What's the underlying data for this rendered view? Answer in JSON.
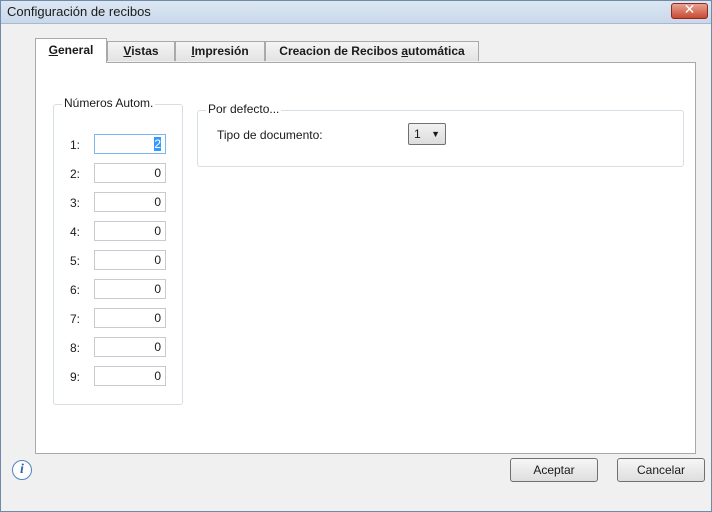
{
  "window": {
    "title": "Configuración de recibos",
    "close_glyph": "✕"
  },
  "tabs": [
    {
      "label_u": "G",
      "label_rest": "eneral",
      "active": true
    },
    {
      "label_u": "V",
      "label_rest": "istas"
    },
    {
      "label_u": "I",
      "label_rest": "mpresión"
    },
    {
      "label_pre": "Creacion de Recibos ",
      "label_u": "a",
      "label_rest": "utomática"
    }
  ],
  "numeros_group": {
    "legend": "Números Autom.",
    "rows": [
      {
        "label": "1:",
        "value": "2"
      },
      {
        "label": "2:",
        "value": "0"
      },
      {
        "label": "3:",
        "value": "0"
      },
      {
        "label": "4:",
        "value": "0"
      },
      {
        "label": "5:",
        "value": "0"
      },
      {
        "label": "6:",
        "value": "0"
      },
      {
        "label": "7:",
        "value": "0"
      },
      {
        "label": "8:",
        "value": "0"
      },
      {
        "label": "9:",
        "value": "0"
      }
    ]
  },
  "defecto_group": {
    "legend": "Por defecto...",
    "tipo_label": "Tipo de documento:",
    "tipo_value": "1",
    "tipo_arrow": "▼"
  },
  "footer": {
    "info_glyph": "i",
    "info_icon": "info-icon",
    "accept_label": "Aceptar",
    "cancel_label": "Cancelar"
  }
}
